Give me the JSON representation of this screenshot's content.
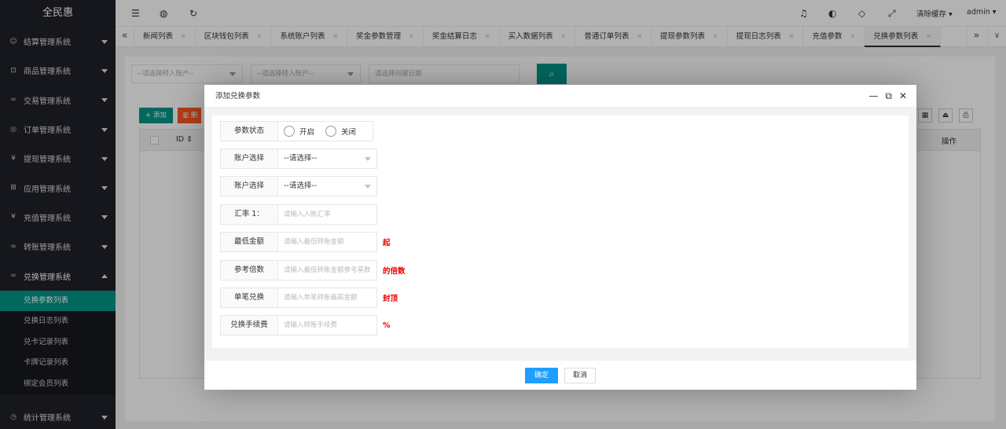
{
  "app": {
    "title": "全民惠"
  },
  "sidebar": {
    "items": [
      {
        "label": "结算管理系统",
        "icon": "smile-icon"
      },
      {
        "label": "商品管理系统",
        "icon": "cart-icon"
      },
      {
        "label": "交易管理系统",
        "icon": "link-icon"
      },
      {
        "label": "订单管理系统",
        "icon": "location-icon"
      },
      {
        "label": "提现管理系统",
        "icon": "yen-icon"
      },
      {
        "label": "应用管理系统",
        "icon": "app-icon"
      },
      {
        "label": "充值管理系统",
        "icon": "yen-icon"
      },
      {
        "label": "转账管理系统",
        "icon": "link-icon"
      },
      {
        "label": "兑换管理系统",
        "icon": "link-icon"
      }
    ],
    "sub_items": [
      {
        "label": "兑换参数列表"
      },
      {
        "label": "兑换日志列表"
      },
      {
        "label": "兑卡记录列表"
      },
      {
        "label": "卡牌记录列表"
      },
      {
        "label": "绑定会员列表"
      }
    ],
    "bottom_item": {
      "label": "统计管理系统",
      "icon": "dashboard-icon"
    }
  },
  "header": {
    "clear_cache": "清除缓存",
    "user": "admin"
  },
  "tabs": [
    {
      "label": "新闻列表"
    },
    {
      "label": "区块钱包列表"
    },
    {
      "label": "系统账户列表"
    },
    {
      "label": "奖金参数管理"
    },
    {
      "label": "奖金结算日志"
    },
    {
      "label": "买入数据列表"
    },
    {
      "label": "普通订单列表"
    },
    {
      "label": "提现参数列表"
    },
    {
      "label": "提现日志列表"
    },
    {
      "label": "充值参数"
    },
    {
      "label": "兑换参数列表"
    }
  ],
  "filters": {
    "from_account": "--请选择转入账户--",
    "to_account": "--请选择转入账户--",
    "date": "请选择创建日期"
  },
  "toolbar": {
    "add": "添加",
    "delete": "删除"
  },
  "table": {
    "col_id": "ID",
    "col_ops": "操作"
  },
  "dialog": {
    "title": "添加兑换参数",
    "status_label": "参数状态",
    "radio_on": "开启",
    "radio_off": "关闭",
    "account1_label": "账户选择",
    "account1_value": "--请选择--",
    "account2_label": "账户选择",
    "account2_value": "--请选择--",
    "rate_label": "汇率 1：",
    "rate_placeholder": "请输入入账汇率",
    "min_label": "最低金额",
    "min_placeholder": "请输入最低转账金额",
    "min_suffix": "起",
    "multiple_label": "参考倍数",
    "multiple_placeholder": "请输入最低转账金额参考基数",
    "multiple_suffix": "的倍数",
    "single_label": "单笔兑换",
    "single_placeholder": "请输入单笔转账最高金额",
    "single_suffix": "封顶",
    "fee_label": "兑换手续费",
    "fee_placeholder": "请输入转账手续费",
    "fee_suffix": "%",
    "ok": "确定",
    "cancel": "取消"
  }
}
